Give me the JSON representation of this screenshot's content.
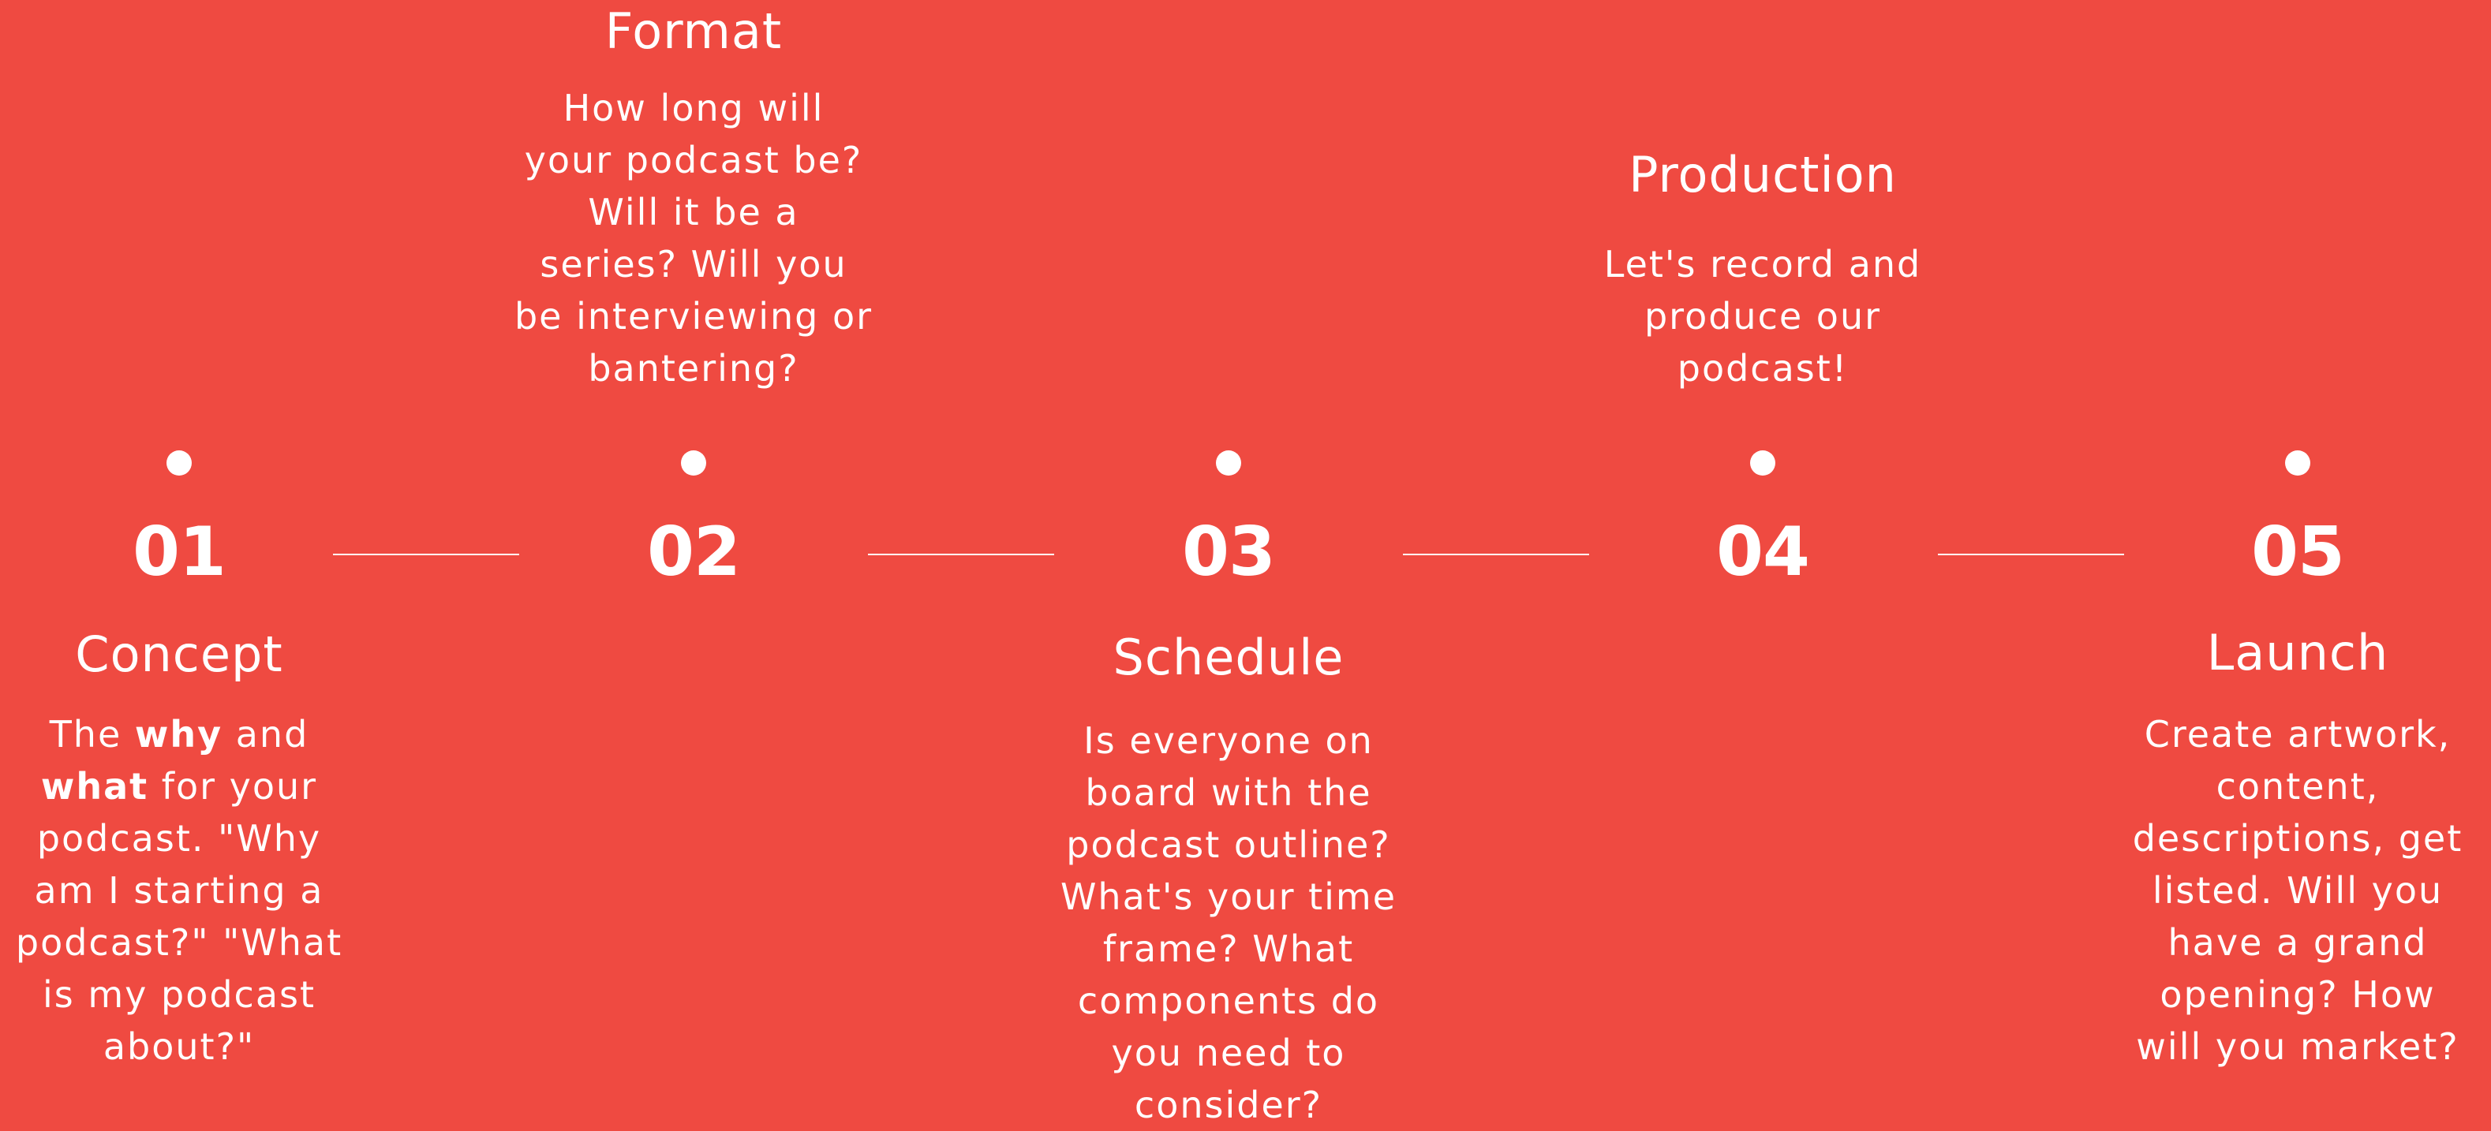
{
  "steps": [
    {
      "number": "01",
      "title": "Concept",
      "description_parts": [
        "The ",
        "why",
        " and\n",
        "what",
        " for your\npodcast. \"Why\nam I starting a\npodcast?\" \"What\nis my podcast\nabout?\""
      ]
    },
    {
      "number": "02",
      "title": "Format",
      "description": "How long will\nyour podcast be?\nWill it be a\nseries? Will you\nbe interviewing or\nbantering?"
    },
    {
      "number": "03",
      "title": "Schedule",
      "description": "Is everyone on\nboard with the\npodcast outline?\nWhat's your time\nframe? What\ncomponents do\nyou need to\nconsider?"
    },
    {
      "number": "04",
      "title": "Production",
      "description": "Let's record and\nproduce our\npodcast!"
    },
    {
      "number": "05",
      "title": "Launch",
      "description": "Create artwork,\ncontent,\ndescriptions, get\nlisted. Will you\nhave a grand\nopening? How\nwill you market?"
    }
  ],
  "colors": {
    "background": "#ef4a41",
    "foreground": "#ffffff"
  }
}
